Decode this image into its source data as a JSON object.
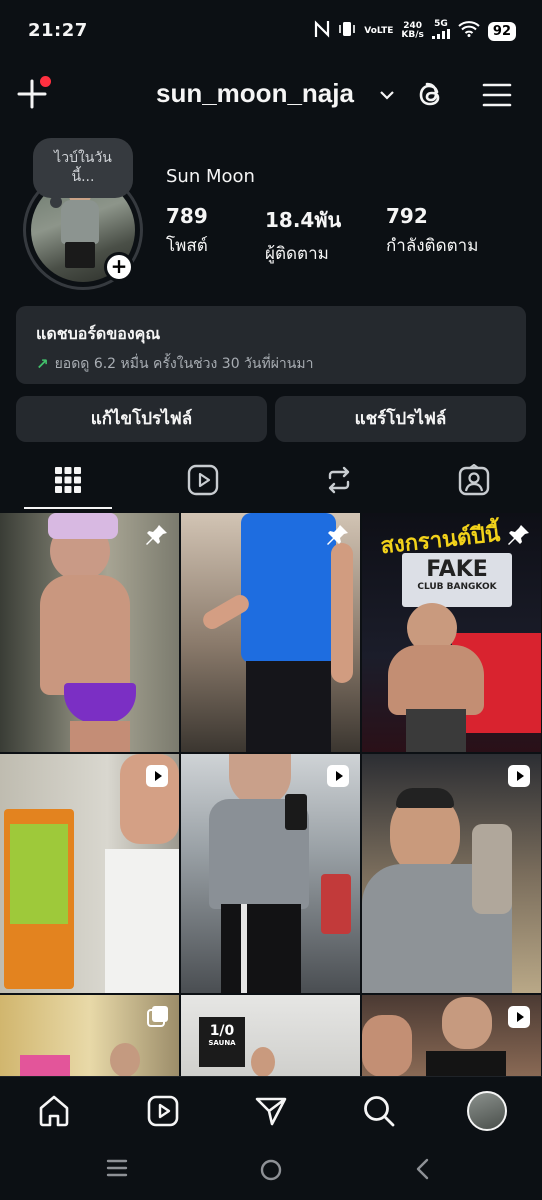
{
  "status": {
    "time": "21:27",
    "network_type": "VoLTE",
    "speed": "240",
    "speed_unit": "KB/s",
    "signal": "5G",
    "battery": "92"
  },
  "header": {
    "username": "sun_moon_naja",
    "icons": [
      "plus-icon",
      "chevron-down-icon",
      "threads-icon",
      "hamburger-menu-icon"
    ]
  },
  "profile": {
    "note_line1": "ไวบ์ในวัน",
    "note_line2": "นี้...",
    "full_name": "Sun Moon",
    "stats": [
      {
        "value": "789",
        "label": "โพสต์"
      },
      {
        "value": "18.4พัน",
        "label": "ผู้ติดตาม"
      },
      {
        "value": "792",
        "label": "กำลังติดตาม"
      }
    ]
  },
  "dashboard": {
    "title": "แดชบอร์ดของคุณ",
    "subtitle": "ยอดดู 6.2 หมื่น ครั้งในช่วง 30 วันที่ผ่านมา",
    "accent": "#42c16b"
  },
  "actions": {
    "edit_profile": "แก้ไขโปรไฟล์",
    "share_profile": "แชร์โปรไฟล์"
  },
  "tabs": [
    "grid-icon",
    "reels-icon",
    "reposts-icon",
    "tagged-icon"
  ],
  "grid": {
    "posts": [
      {
        "badge": "pin",
        "caption": ""
      },
      {
        "badge": "pin",
        "caption": ""
      },
      {
        "badge": "pin",
        "caption": "สงกรานต์ปีนี้"
      },
      {
        "badge": "reel",
        "caption": ""
      },
      {
        "badge": "reel",
        "caption": ""
      },
      {
        "badge": "reel",
        "caption": ""
      },
      {
        "badge": "multi",
        "caption": ""
      },
      {
        "badge": "none",
        "caption": "1/0"
      },
      {
        "badge": "reel",
        "caption": ""
      }
    ],
    "sign_text": "FAKE",
    "sign_sub": "CLUB BANGKOK",
    "sauna_sub": "SAUNA"
  },
  "bottom_nav": [
    "home-icon",
    "reels-icon",
    "send-icon",
    "search-icon",
    "profile-avatar"
  ],
  "system_nav": [
    "recents-icon",
    "home-circle-icon",
    "back-icon"
  ]
}
